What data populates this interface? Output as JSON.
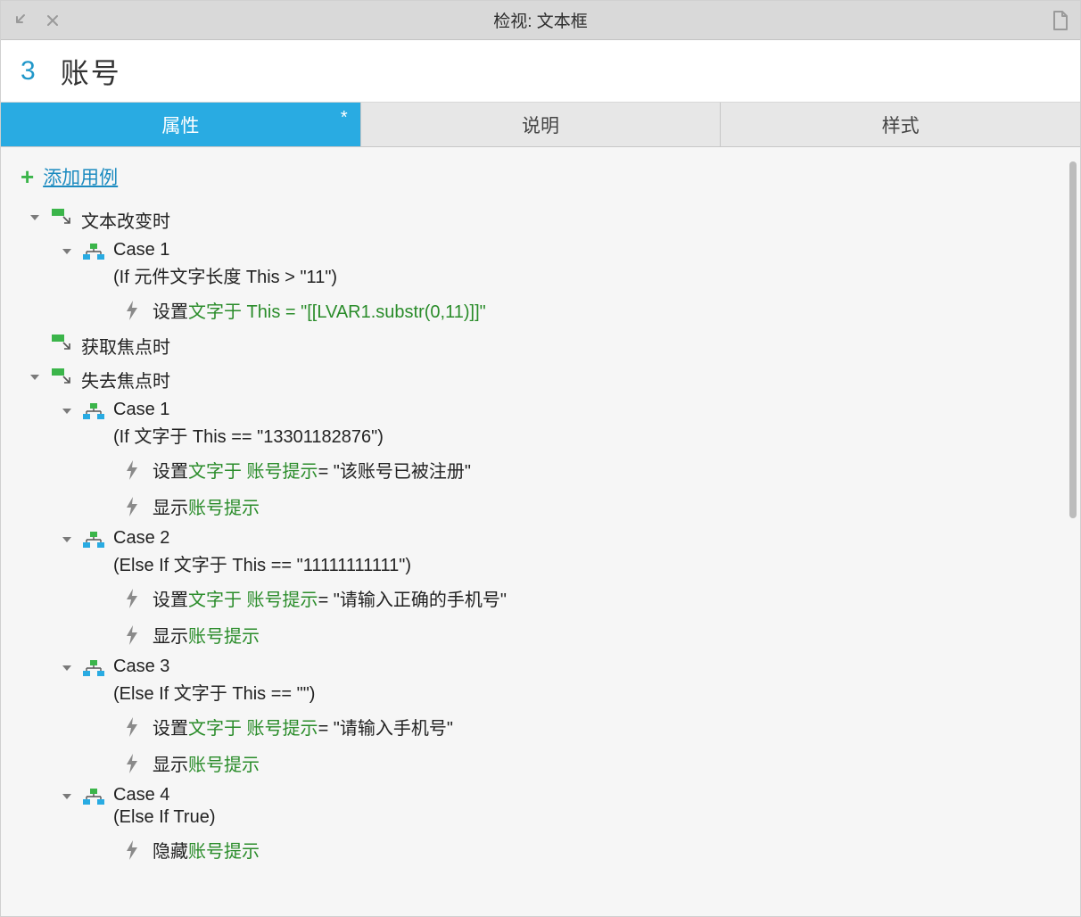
{
  "titlebar": {
    "title": "检视: 文本框"
  },
  "header": {
    "index": "3",
    "name": "账号"
  },
  "tabs": {
    "properties": "属性",
    "notes": "说明",
    "style": "样式",
    "dirty": "*"
  },
  "add_case": "添加用例",
  "events": {
    "onTextChange": {
      "label": "文本改变时",
      "cases": {
        "c1": {
          "title": "Case 1",
          "condition": "(If 元件文字长度 This > \"11\")",
          "actions": {
            "a1": {
              "verb": "设置 ",
              "green": "文字于 This = \"[[LVAR1.substr(0,11)]]\""
            }
          }
        }
      }
    },
    "onFocus": {
      "label": "获取焦点时"
    },
    "onBlur": {
      "label": "失去焦点时",
      "cases": {
        "c1": {
          "title": "Case 1",
          "condition": "(If 文字于 This == \"13301182876\")",
          "actions": {
            "a1": {
              "verb": "设置 ",
              "green1": "文字于 账号提示",
              "black": " = \"该账号已被注册\""
            },
            "a2": {
              "verb": "显示 ",
              "green1": "账号提示"
            }
          }
        },
        "c2": {
          "title": "Case 2",
          "condition": "(Else If 文字于 This == \"11111111111\")",
          "actions": {
            "a1": {
              "verb": "设置 ",
              "green1": "文字于 账号提示",
              "black": " = \"请输入正确的手机号\""
            },
            "a2": {
              "verb": "显示 ",
              "green1": "账号提示"
            }
          }
        },
        "c3": {
          "title": "Case 3",
          "condition": "(Else If 文字于 This == \"\")",
          "actions": {
            "a1": {
              "verb": "设置 ",
              "green1": "文字于 账号提示",
              "black": " = \"请输入手机号\""
            },
            "a2": {
              "verb": "显示 ",
              "green1": "账号提示"
            }
          }
        },
        "c4": {
          "title": "Case 4",
          "condition": "(Else If True)",
          "actions": {
            "a1": {
              "verb": "隐藏 ",
              "green1": "账号提示"
            }
          }
        }
      }
    }
  }
}
